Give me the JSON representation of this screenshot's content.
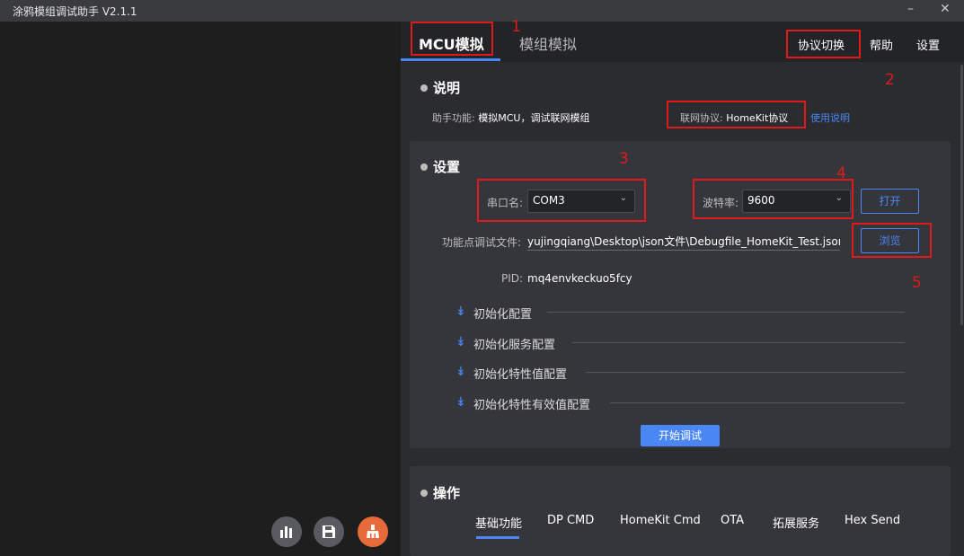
{
  "window": {
    "title": "涂鸦模组调试助手 V2.1.1",
    "minimize": "–",
    "close": "✕"
  },
  "tabs": [
    {
      "label": "MCU模拟",
      "active": true
    },
    {
      "label": "模组模拟",
      "active": false
    }
  ],
  "menu": {
    "protocol_switch": "协议切换",
    "help": "帮助",
    "settings": "设置"
  },
  "description": {
    "title": "说明",
    "function_label": "助手功能:",
    "function_value": "模拟MCU，调试联网模组",
    "protocol_label": "联网协议:",
    "protocol_value": "HomeKit协议",
    "usage_link": "使用说明"
  },
  "settings": {
    "title": "设置",
    "port_label": "串口名:",
    "port_value": "COM3",
    "baud_label": "波特率:",
    "baud_value": "9600",
    "open_button": "打开",
    "file_label": "功能点调试文件:",
    "file_value": "yujingqiang\\Desktop\\json文件\\Debugfile_HomeKit_Test.json",
    "browse_button": "浏览",
    "pid_label": "PID:",
    "pid_value": "mq4envkeckuo5fcy",
    "expanders": [
      "初始化配置",
      "初始化服务配置",
      "初始化特性值配置",
      "初始化特性有效值配置"
    ],
    "start_button": "开始调试"
  },
  "operations": {
    "title": "操作",
    "tabs": [
      "基础功能",
      "DP CMD",
      "HomeKit Cmd",
      "OTA",
      "拓展服务",
      "Hex Send"
    ]
  },
  "bottom_buttons": [
    {
      "icon": "bar-chart-icon",
      "color": "#5a5b60"
    },
    {
      "icon": "save-icon",
      "color": "#5a5b60"
    },
    {
      "icon": "broom-icon",
      "color": "#e86a3a"
    }
  ],
  "annotations": [
    "1",
    "2",
    "3",
    "4",
    "5"
  ],
  "colors": {
    "accent": "#4a87f5",
    "annotation": "#e0191b",
    "panel": "#35363b"
  }
}
